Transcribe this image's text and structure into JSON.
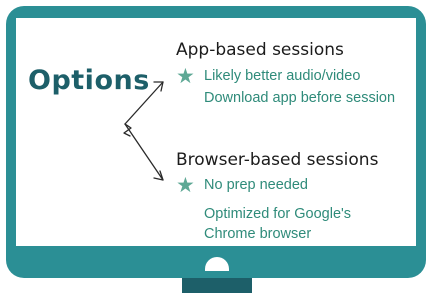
{
  "title": "Options",
  "app_sessions": {
    "heading": "App-based sessions",
    "bullets": [
      "Likely  better audio/video",
      "Download app before session"
    ]
  },
  "browser_sessions": {
    "heading": "Browser-based sessions",
    "bullets": [
      "No prep needed",
      "Optimized for Google's",
      "Chrome browser"
    ]
  },
  "colors": {
    "frame": "#2b8f95",
    "title": "#1d5f69",
    "stand": "#1d5f69",
    "bullet_text": "#2f8b7a",
    "star": "#5ea895"
  }
}
